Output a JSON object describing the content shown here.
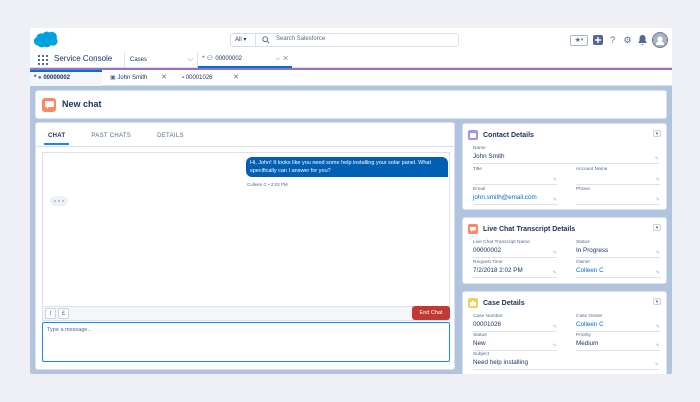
{
  "header": {
    "search_scope": "All",
    "search_placeholder": "Search Salesforce"
  },
  "nav": {
    "app_name": "Service Console",
    "object_select": "Cases",
    "active_tab": "00000002"
  },
  "subtabs": [
    {
      "label": "00000002"
    },
    {
      "label": "John Smith"
    },
    {
      "label": "00001026"
    }
  ],
  "page": {
    "title": "New chat"
  },
  "chat": {
    "tabs": [
      "CHAT",
      "PAST CHATS",
      "DETAILS"
    ],
    "message": "Hi, John! It looks like you need some help installing your solar panel. What specifically can I answer for you?",
    "message_meta": "Colleen C • 2:03 PM",
    "end_chat_label": "End Chat",
    "input_placeholder": "Type a message..."
  },
  "contact_card": {
    "title": "Contact Details",
    "fields": [
      {
        "label": "Name",
        "value": "John Smith"
      },
      {
        "label": "Title",
        "value": ""
      },
      {
        "label": "Account Name",
        "value": ""
      },
      {
        "label": "Email",
        "value": "john.smith@email.com"
      },
      {
        "label": "Phone",
        "value": ""
      }
    ]
  },
  "transcript_card": {
    "title": "Live Chat Transcript Details",
    "fields": [
      {
        "label": "Live Chat Transcript Name",
        "value": "00000002"
      },
      {
        "label": "Status",
        "value": "In Progress"
      },
      {
        "label": "Request Time",
        "value": "7/2/2018 2:02 PM"
      },
      {
        "label": "Owner",
        "value": "Colleen C"
      }
    ]
  },
  "case_card": {
    "title": "Case Details",
    "fields": [
      {
        "label": "Case Number",
        "value": "00001026"
      },
      {
        "label": "Case Owner",
        "value": "Colleen C"
      },
      {
        "label": "Status",
        "value": "New"
      },
      {
        "label": "Priority",
        "value": "Medium"
      },
      {
        "label": "Subject",
        "value": "Need help installing"
      }
    ]
  },
  "colors": {
    "brand_blue": "#00a1e0",
    "accent": "#0070d2",
    "chat_icon": "#f88962",
    "end_chat": "#c23934",
    "contact_icon": "#a094ed",
    "transcript_icon": "#f88962",
    "case_icon": "#f2cf5b"
  }
}
